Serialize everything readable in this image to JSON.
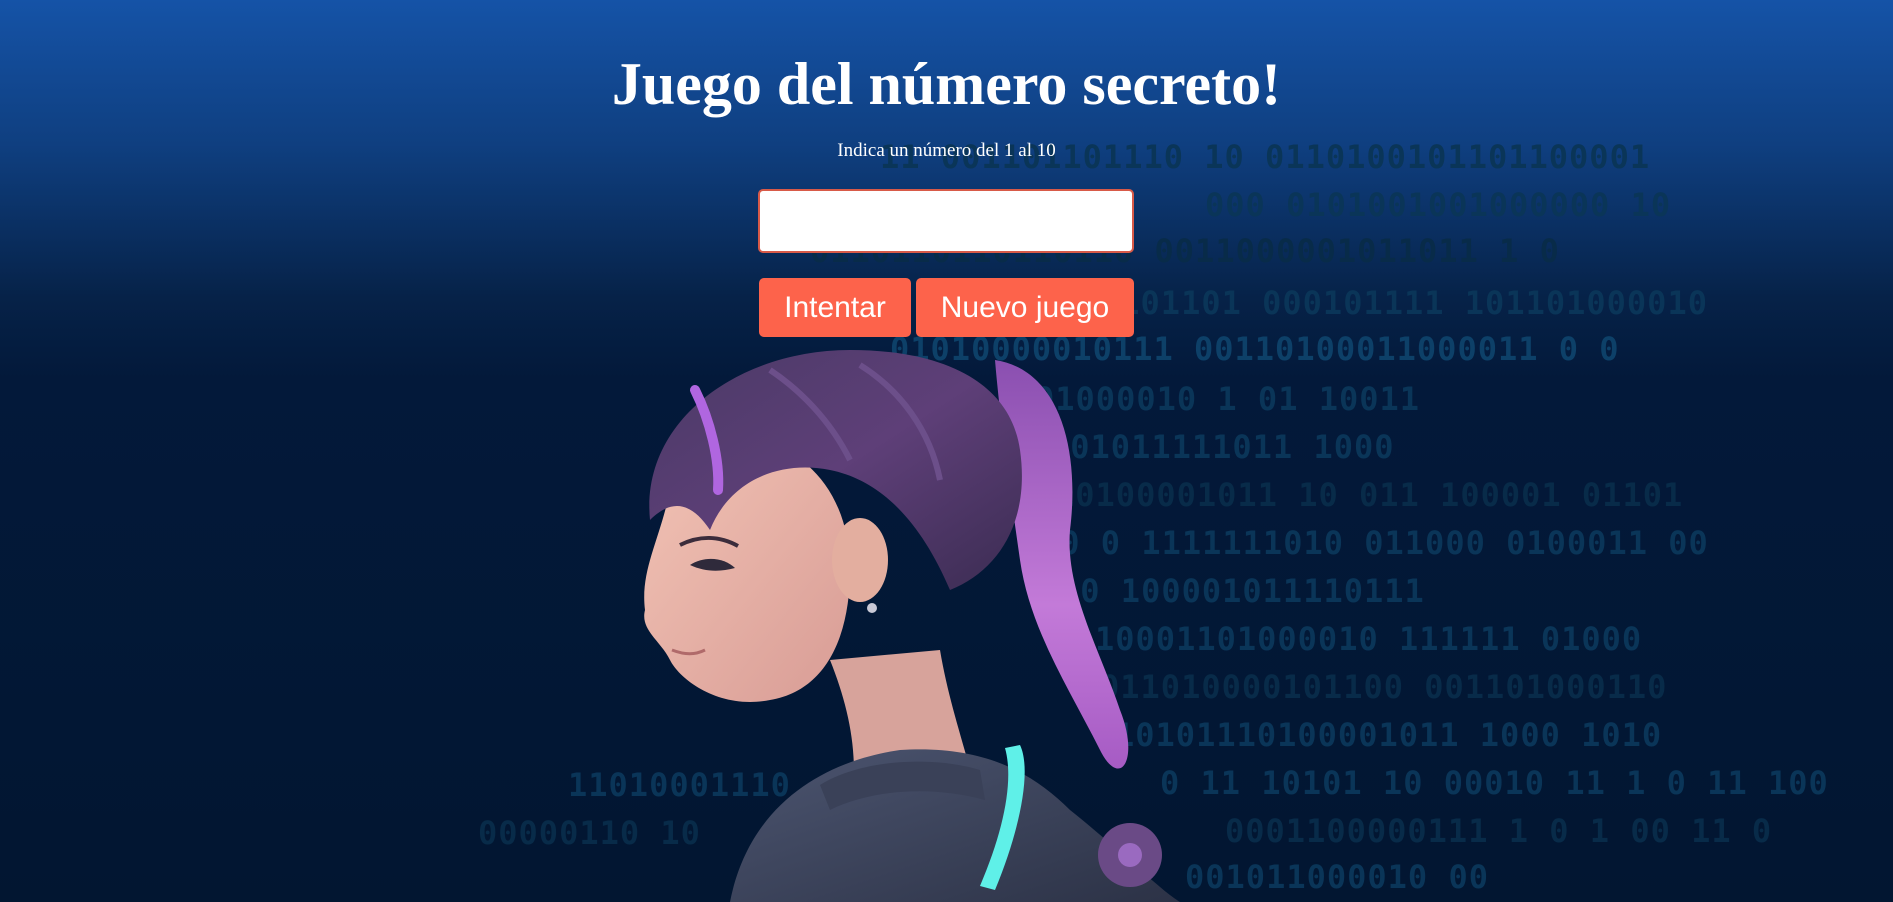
{
  "header": {
    "title": "Juego del número secreto!",
    "instruction": "Indica un número del 1 al 10"
  },
  "input": {
    "value": "",
    "placeholder": ""
  },
  "buttons": {
    "try_label": "Intentar",
    "new_game_label": "Nuevo juego"
  },
  "background": {
    "binary_lines": [
      "11 001101101110 10 0110100101101100001",
      "000 0101001001000000 10",
      "0110110110110110 0011000001011011 1 0",
      "0101101 000101111 101101000010",
      "01010000010111 00110100011000011 0 0",
      "01000010 1 01 10011",
      "001011111011 1000",
      "10100001011 10 011 100001 01101",
      "00 0 1111111010 011000 0100011 00",
      "10 100001011110111",
      "10001101000010 111111 01000",
      "011010000101100 001101000110",
      "10101110100001011 1000 1010",
      "0 11 10101 10 00010 11 1 0 11 100",
      "0001100000111 1 0 1 00 11 0",
      "001011000010 00",
      "11010001110",
      "00000110 10"
    ]
  },
  "colors": {
    "accent": "#fd634b",
    "input_border": "#d85a48",
    "bg_top": "#1553a7",
    "bg_bottom": "#021631"
  },
  "illustration": {
    "icon": "cyber-girl-illustration"
  }
}
